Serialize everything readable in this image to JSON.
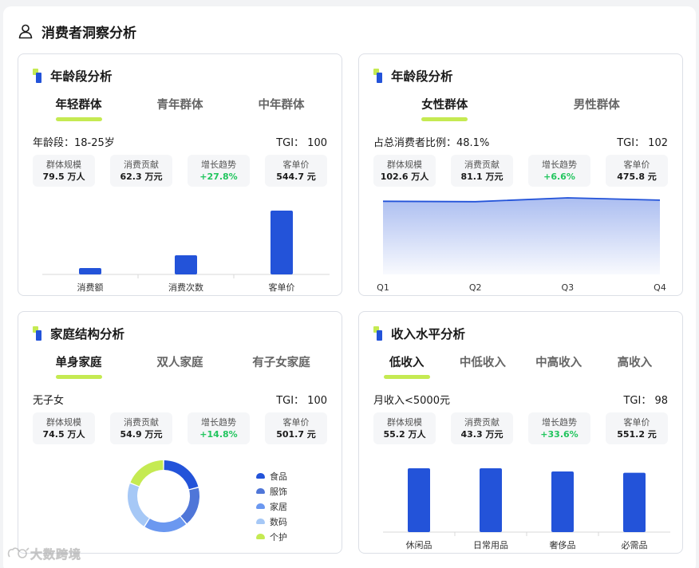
{
  "header": {
    "title": "消费者洞察分析"
  },
  "colors": {
    "accent": "#2353d9",
    "lime": "#c5ea52",
    "green": "#22c55e"
  },
  "cards": [
    {
      "title": "年龄段分析",
      "tabs": [
        "年轻群体",
        "青年群体",
        "中年群体"
      ],
      "info": "年龄段：18-25岁",
      "tgi": "TGI： 100",
      "stats": [
        {
          "label": "群体规模",
          "value": "79.5 万人"
        },
        {
          "label": "消费贡献",
          "value": "62.3 万元"
        },
        {
          "label": "增长趋势",
          "value": "+27.8%"
        },
        {
          "label": "客单价",
          "value": "544.7 元"
        }
      ]
    },
    {
      "title": "年龄段分析",
      "tabs": [
        "女性群体",
        "男性群体"
      ],
      "info": "占总消费者比例：48.1%",
      "tgi": "TGI： 102",
      "stats": [
        {
          "label": "群体规模",
          "value": "102.6 万人"
        },
        {
          "label": "消费贡献",
          "value": "81.1 万元"
        },
        {
          "label": "增长趋势",
          "value": "+6.6%"
        },
        {
          "label": "客单价",
          "value": "475.8 元"
        }
      ]
    },
    {
      "title": "家庭结构分析",
      "tabs": [
        "单身家庭",
        "双人家庭",
        "有子女家庭"
      ],
      "info": "无子女",
      "tgi": "TGI： 100",
      "stats": [
        {
          "label": "群体规模",
          "value": "74.5 万人"
        },
        {
          "label": "消费贡献",
          "value": "54.9 万元"
        },
        {
          "label": "增长趋势",
          "value": "+14.8%"
        },
        {
          "label": "客单价",
          "value": "501.7 元"
        }
      ]
    },
    {
      "title": "收入水平分析",
      "tabs": [
        "低收入",
        "中低收入",
        "中高收入",
        "高收入"
      ],
      "info": "月收入<5000元",
      "tgi": "TGI： 98",
      "stats": [
        {
          "label": "群体规模",
          "value": "55.2 万人"
        },
        {
          "label": "消费贡献",
          "value": "43.3 万元"
        },
        {
          "label": "增长趋势",
          "value": "+33.6%"
        },
        {
          "label": "客单价",
          "value": "551.2 元"
        }
      ]
    }
  ],
  "watermark": "大数跨境",
  "chart_data": [
    {
      "type": "bar",
      "categories": [
        "消费额",
        "消费次数",
        "客单价"
      ],
      "values": [
        10,
        30,
        100
      ],
      "ylim": [
        0,
        105
      ],
      "color": "#2353d9"
    },
    {
      "type": "area",
      "categories": [
        "Q1",
        "Q2",
        "Q3",
        "Q4"
      ],
      "values": [
        95.5,
        95.0,
        100,
        97
      ],
      "ylim": [
        0,
        100
      ],
      "color": "#2353d9"
    },
    {
      "type": "pie",
      "categories": [
        "食品",
        "服饰",
        "家居",
        "数码",
        "个护"
      ],
      "values": [
        21,
        18,
        20,
        22,
        19
      ],
      "colors": [
        "#2353d9",
        "#4f76d8",
        "#6b98f0",
        "#a6c8f6",
        "#c5ea52"
      ]
    },
    {
      "type": "bar",
      "categories": [
        "休闲品",
        "日常用品",
        "奢侈品",
        "必需品"
      ],
      "values": [
        100,
        100,
        95,
        93
      ],
      "ylim": [
        0,
        100
      ],
      "color": "#2353d9"
    }
  ]
}
